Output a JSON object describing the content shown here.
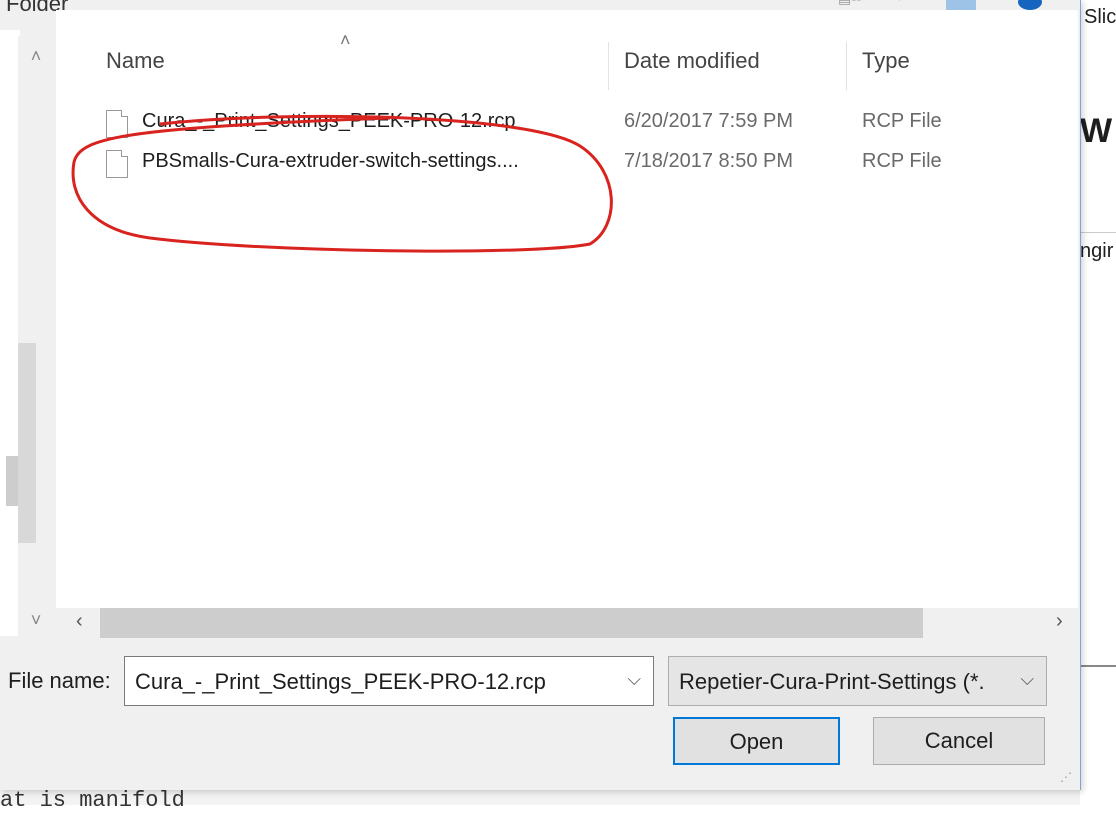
{
  "window": {
    "top_title_fragment": "Folder",
    "right_fragments": {
      "top": "Slice",
      "mid": "W",
      "lower": "ngir"
    },
    "console_fragment": "at is manifold"
  },
  "columns": [
    {
      "label": "Name"
    },
    {
      "label": "Date modified"
    },
    {
      "label": "Type"
    }
  ],
  "files": [
    {
      "name": "Cura_-_Print_Settings_PEEK-PRO-12.rcp",
      "date": "6/20/2017 7:59 PM",
      "type": "RCP File"
    },
    {
      "name": "PBSmalls-Cura-extruder-switch-settings....",
      "date": "7/18/2017 8:50 PM",
      "type": "RCP File"
    }
  ],
  "filename": {
    "label": "File name:",
    "value": "Cura_-_Print_Settings_PEEK-PRO-12.rcp"
  },
  "filter": {
    "value": "Repetier-Cura-Print-Settings (*."
  },
  "buttons": {
    "open": "Open",
    "cancel": "Cancel"
  },
  "colors": {
    "annotation": "#d9231f",
    "accent": "#0078d7"
  },
  "icons": [
    "file-icon",
    "sort-up-icon",
    "scroll-up-icon",
    "scroll-down-icon",
    "scroll-left-icon",
    "scroll-right-icon",
    "chevron-down-icon",
    "help-icon"
  ]
}
